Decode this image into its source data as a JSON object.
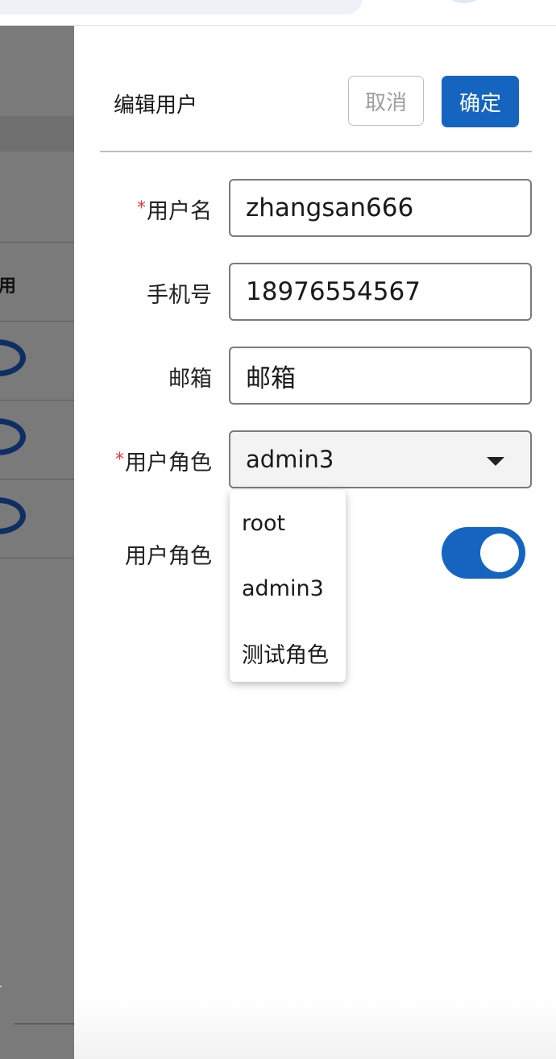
{
  "backdrop": {
    "column_header": "用"
  },
  "drawer": {
    "title": "编辑用户",
    "cancel_label": "取消",
    "confirm_label": "确定"
  },
  "form": {
    "username": {
      "label": "用户名",
      "required_mark": "*",
      "value": "zhangsan666"
    },
    "phone": {
      "label": "手机号",
      "value": "18976554567"
    },
    "email": {
      "label": "邮箱",
      "placeholder": "邮箱"
    },
    "role": {
      "label": "用户角色",
      "required_mark": "*",
      "value": "admin3",
      "options": [
        "root",
        "admin3",
        "测试角色"
      ]
    },
    "role_status": {
      "label": "用户角色",
      "toggle_on": true
    }
  },
  "colors": {
    "primary": "#1565c0",
    "required": "#e53935",
    "backdrop": "#7a7a7a"
  }
}
